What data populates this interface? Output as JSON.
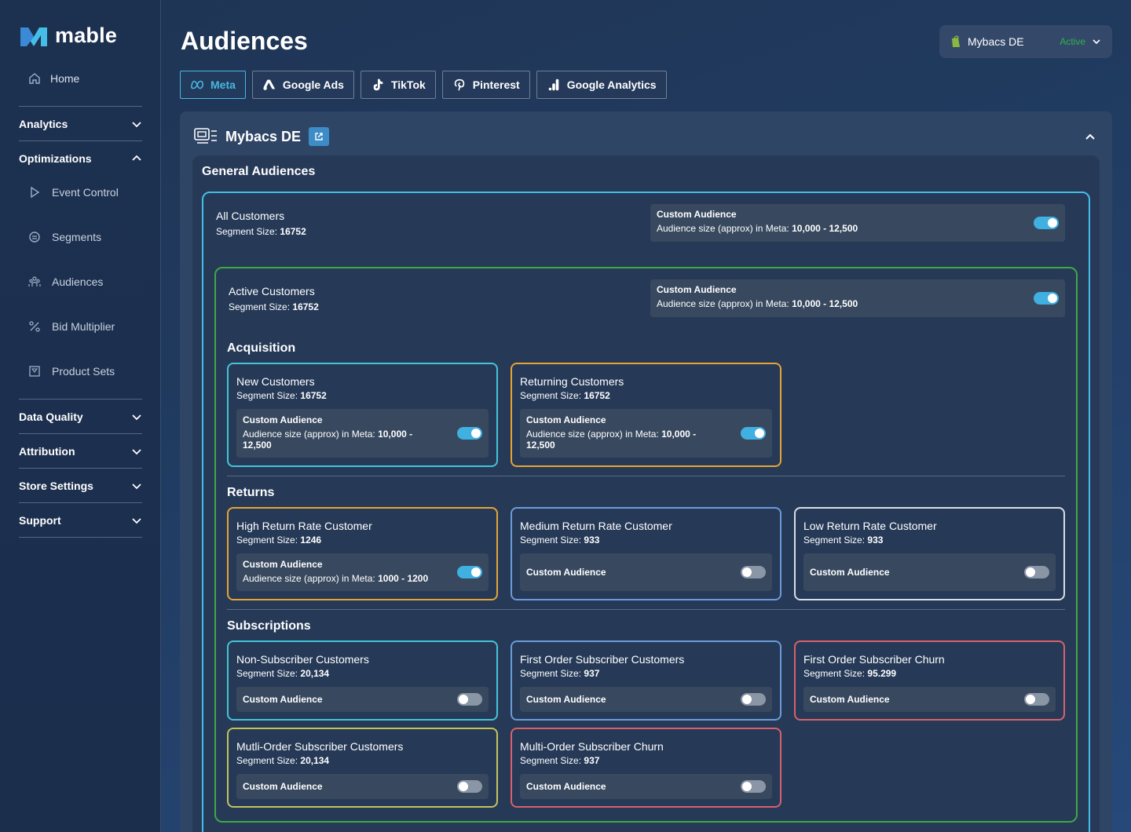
{
  "app": {
    "logo_text": "mable"
  },
  "sidebar": {
    "home": "Home",
    "sections": {
      "analytics": "Analytics",
      "optimizations": "Optimizations",
      "data_quality": "Data Quality",
      "attribution": "Attribution",
      "store_settings": "Store Settings",
      "support": "Support"
    },
    "sub": {
      "event_control": "Event Control",
      "segments": "Segments",
      "audiences": "Audiences",
      "bid_multiplier": "Bid Multiplier",
      "product_sets": "Product Sets"
    }
  },
  "header": {
    "title": "Audiences",
    "store": {
      "name": "Mybacs DE",
      "status": "Active",
      "status_color": "#2db24a"
    }
  },
  "tabs": [
    "Meta",
    "Google Ads",
    "TikTok",
    "Pinterest",
    "Google Analytics"
  ],
  "panel": {
    "account": "Mybacs DE",
    "general_title": "General Audiences",
    "custom_label": "Custom Audience",
    "size_label": "Segment Size:",
    "all": {
      "name": "All Customers",
      "size": "16752",
      "aud": "Audience size (approx) in Meta:",
      "range": "10,000 - 12,500",
      "on": true
    },
    "active": {
      "name": "Active Customers",
      "size": "16752",
      "aud": "Audience size (approx) in Meta:",
      "range": "10,000 - 12,500",
      "on": true
    },
    "acquisition": {
      "title": "Acquisition",
      "new": {
        "name": "New Customers",
        "size": "16752",
        "aud": "Audience size (approx) in Meta:",
        "range": "10,000 -",
        "range2": "12,500",
        "on": true
      },
      "returning": {
        "name": "Returning Customers",
        "size": "16752",
        "aud": "Audience size (approx) in Meta:",
        "range": "10,000 -",
        "range2": "12,500",
        "on": true
      }
    },
    "returns": {
      "title": "Returns",
      "high": {
        "name": "High Return Rate Customer",
        "size": "1246",
        "aud": "Audience size (approx) in Meta:",
        "range": "1000 - 1200",
        "on": true
      },
      "medium": {
        "name": "Medium Return Rate Customer",
        "size": "933",
        "on": false
      },
      "low": {
        "name": "Low Return Rate Customer",
        "size": "933",
        "on": false
      }
    },
    "subscriptions": {
      "title": "Subscriptions",
      "non_sub": {
        "name": "Non-Subscriber Customers",
        "size": "20,134",
        "on": false
      },
      "first_sub": {
        "name": "First Order Subscriber Customers",
        "size": "937",
        "on": false
      },
      "first_churn": {
        "name": "First Order Subscriber Churn",
        "size": "95.299",
        "on": false
      },
      "multi_sub": {
        "name": "Mutli-Order Subscriber Customers",
        "size": "20,134",
        "on": false
      },
      "multi_churn": {
        "name": "Multi-Order Subscriber Churn",
        "size": "937",
        "on": false
      }
    }
  },
  "colors": {
    "accent": "#4ab7e0",
    "all_border": "#45bde8",
    "active_border": "#3ea843",
    "cyan": "#44c4d6",
    "orange": "#e7a335",
    "blue": "#6a9bd8",
    "white": "#d8dde5",
    "red": "#d9606b",
    "olive": "#c3c35a"
  }
}
